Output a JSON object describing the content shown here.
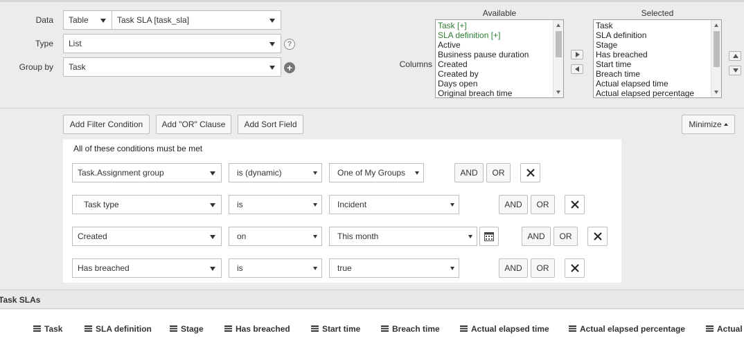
{
  "report": {
    "data_label": "Data",
    "data_source_type": "Table",
    "data_table": "Task SLA [task_sla]",
    "type_label": "Type",
    "type_value": "List",
    "group_by_label": "Group by",
    "group_by_value": "Task",
    "help_glyph": "?",
    "add_glyph": "+"
  },
  "columns": {
    "label": "Columns",
    "available_header": "Available",
    "selected_header": "Selected",
    "available": [
      "Task [+]",
      "SLA definition [+]",
      "Active",
      "Business pause duration",
      "Created",
      "Created by",
      "Days open",
      "Original breach time"
    ],
    "selected": [
      "Task",
      "SLA definition",
      "Stage",
      "Has breached",
      "Start time",
      "Breach time",
      "Actual elapsed time",
      "Actual elapsed percentage"
    ]
  },
  "toolbar": {
    "add_filter": "Add Filter Condition",
    "add_or": "Add \"OR\" Clause",
    "add_sort": "Add Sort Field",
    "minimize": "Minimize"
  },
  "conditions": {
    "title": "All of these conditions must be met",
    "and_label": "AND",
    "or_label": "OR",
    "rows": [
      {
        "field": "Task.Assignment group",
        "operator": "is (dynamic)",
        "value": "One of My Groups"
      },
      {
        "field": "Task type",
        "operator": "is",
        "value": "Incident"
      },
      {
        "field": "Created",
        "operator": "on",
        "value": "This month"
      },
      {
        "field": "Has breached",
        "operator": "is",
        "value": "true"
      }
    ]
  },
  "results": {
    "title": "Task SLAs",
    "columns": [
      "Task",
      "SLA definition",
      "Stage",
      "Has breached",
      "Start time",
      "Breach time",
      "Actual elapsed time",
      "Actual elapsed percentage",
      "Actual t"
    ]
  },
  "colors": {
    "background": "#ececec",
    "accent_green": "#2e7d32"
  }
}
